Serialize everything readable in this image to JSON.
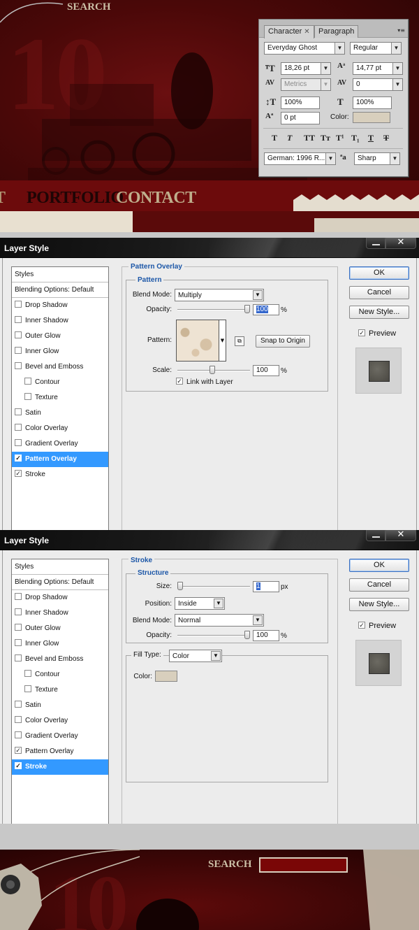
{
  "site": {
    "search_label": "SEARCH",
    "nav": [
      {
        "label": "T"
      },
      {
        "label": "PORTFOLIO"
      },
      {
        "label": "CONTACT"
      }
    ],
    "bg_digits": "10"
  },
  "character_panel": {
    "tabs": [
      "Character",
      "Paragraph"
    ],
    "font_family": "Everyday Ghost",
    "font_style": "Regular",
    "font_size": "18,26 pt",
    "leading": "14,77 pt",
    "kerning": "Metrics",
    "tracking": "0",
    "vertical_scale": "100%",
    "horizontal_scale": "100%",
    "baseline_shift": "0 pt",
    "color_label": "Color:",
    "color": "#d8cfbd",
    "style_buttons": [
      "T",
      "T",
      "TT",
      "Tт",
      "T¹",
      "T₁",
      "T",
      "T"
    ],
    "language": "German: 1996 R...",
    "anti_alias": "Sharp",
    "icons": [
      "font-size-icon",
      "leading-icon",
      "kerning-icon",
      "tracking-icon",
      "vertical-scale-icon",
      "horizontal-scale-icon",
      "baseline-shift-icon",
      "anti-alias-icon"
    ]
  },
  "dialog1": {
    "title": "Layer Style",
    "styles_header": "Styles",
    "blending": "Blending Options: Default",
    "items": [
      {
        "label": "Drop Shadow",
        "checked": false
      },
      {
        "label": "Inner Shadow",
        "checked": false
      },
      {
        "label": "Outer Glow",
        "checked": false
      },
      {
        "label": "Inner Glow",
        "checked": false
      },
      {
        "label": "Bevel and Emboss",
        "checked": false
      },
      {
        "label": "Contour",
        "checked": false
      },
      {
        "label": "Texture",
        "checked": false
      },
      {
        "label": "Satin",
        "checked": false
      },
      {
        "label": "Color Overlay",
        "checked": false
      },
      {
        "label": "Gradient Overlay",
        "checked": false
      },
      {
        "label": "Pattern Overlay",
        "checked": true
      },
      {
        "label": "Stroke",
        "checked": true
      }
    ],
    "section_title": "Pattern Overlay",
    "group_title": "Pattern",
    "blend_mode_label": "Blend Mode:",
    "blend_mode": "Multiply",
    "opacity_label": "Opacity:",
    "opacity": "100",
    "opacity_value": 100,
    "pct": "%",
    "pattern_label": "Pattern:",
    "snap_button": "Snap to Origin",
    "scale_label": "Scale:",
    "scale": "100",
    "link_label": "Link with Layer",
    "link_checked": true,
    "buttons": {
      "ok": "OK",
      "cancel": "Cancel",
      "new_style": "New Style..."
    },
    "preview_label": "Preview",
    "preview_checked": true
  },
  "dialog2": {
    "title": "Layer Style",
    "styles_header": "Styles",
    "blending": "Blending Options: Default",
    "items": [
      {
        "label": "Drop Shadow",
        "checked": false
      },
      {
        "label": "Inner Shadow",
        "checked": false
      },
      {
        "label": "Outer Glow",
        "checked": false
      },
      {
        "label": "Inner Glow",
        "checked": false
      },
      {
        "label": "Bevel and Emboss",
        "checked": false
      },
      {
        "label": "Contour",
        "checked": false
      },
      {
        "label": "Texture",
        "checked": false
      },
      {
        "label": "Satin",
        "checked": false
      },
      {
        "label": "Color Overlay",
        "checked": false
      },
      {
        "label": "Gradient Overlay",
        "checked": false
      },
      {
        "label": "Pattern Overlay",
        "checked": true
      },
      {
        "label": "Stroke",
        "checked": true
      }
    ],
    "section_title": "Stroke",
    "group_title": "Structure",
    "size_label": "Size:",
    "size": "1",
    "size_unit": "px",
    "position_label": "Position:",
    "position": "Inside",
    "blend_mode_label": "Blend Mode:",
    "blend_mode": "Normal",
    "opacity_label": "Opacity:",
    "opacity": "100",
    "opacity_value": 100,
    "pct": "%",
    "fill_type_label": "Fill Type:",
    "fill_type": "Color",
    "color_label": "Color:",
    "stroke_color": "#d8cfbd",
    "buttons": {
      "ok": "OK",
      "cancel": "Cancel",
      "new_style": "New Style..."
    },
    "preview_label": "Preview",
    "preview_checked": true
  }
}
